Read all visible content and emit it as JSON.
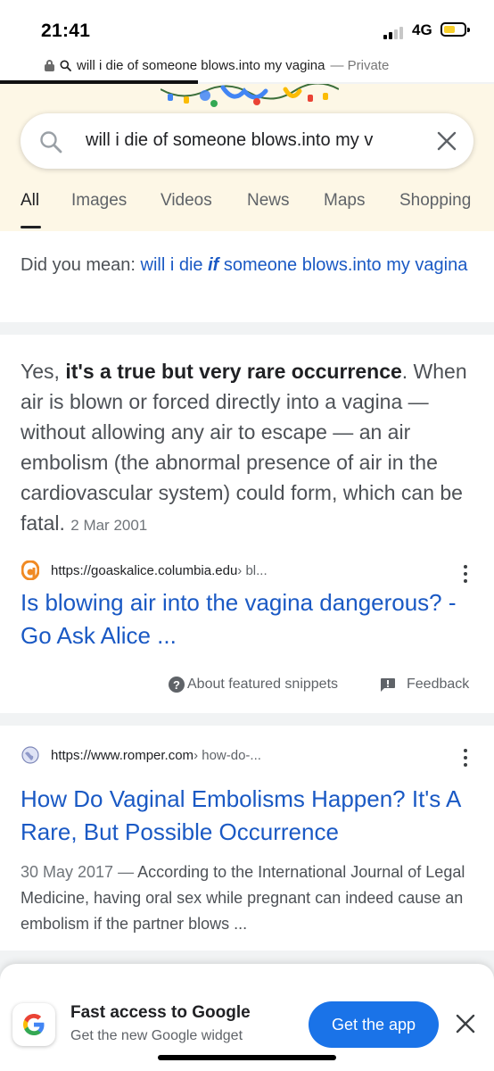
{
  "status_bar": {
    "time": "21:41",
    "network": "4G"
  },
  "url_bar": {
    "query": "will i die of someone blows.into my vagina",
    "private_label": "— Private"
  },
  "search": {
    "query": "will i die of someone blows.into my v"
  },
  "tabs": [
    {
      "label": "All",
      "active": true
    },
    {
      "label": "Images"
    },
    {
      "label": "Videos"
    },
    {
      "label": "News"
    },
    {
      "label": "Maps"
    },
    {
      "label": "Shopping"
    }
  ],
  "did_you_mean": {
    "prefix": "Did you mean: ",
    "link_start": "will i die ",
    "link_correction": "if",
    "link_end": " someone blows.into my vagina"
  },
  "featured_snippet": {
    "lead": "Yes, ",
    "bold": "it's a true but very rare occurrence",
    "body": ". When air is blown or forced directly into a vagina — without allowing any air to escape — an air embolism (the abnormal presence of air in the cardiovascular system) could form, which can be fatal. ",
    "date": "2 Mar 2001",
    "source_domain": "https://goaskalice.columbia.edu",
    "source_path": " › bl...",
    "title": "Is blowing air into the vagina dangerous? - Go Ask Alice ...",
    "about_label": "About featured snippets",
    "feedback_label": "Feedback"
  },
  "result2": {
    "source_domain": "https://www.romper.com",
    "source_path": " › how-do-...",
    "title": "How Do Vaginal Embolisms Happen? It's A Rare, But Possible Occurrence",
    "date": "30 May 2017 — ",
    "description": "According to the International Journal of Legal Medicine, having oral sex while pregnant can indeed cause an embolism if the partner blows ..."
  },
  "promo": {
    "title": "Fast access to Google",
    "subtitle": "Get the new Google widget",
    "button_label": "Get the app"
  },
  "colors": {
    "link_blue": "#1a59c4",
    "accent_blue": "#1a73e8",
    "battery_yellow": "#f7cf2b",
    "doodle_background": "#fdf7e6"
  }
}
